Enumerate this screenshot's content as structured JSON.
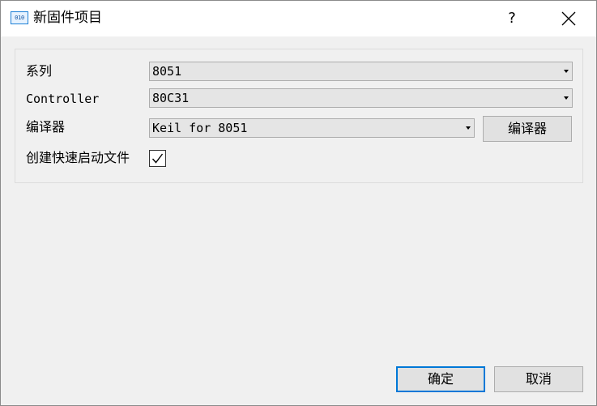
{
  "window": {
    "title": "新固件项目",
    "icon_text": "010",
    "help_label": "?"
  },
  "form": {
    "series_label": "系列",
    "series_value": "8051",
    "controller_label": "Controller",
    "controller_value": "80C31",
    "compiler_label": "编译器",
    "compiler_value": "Keil for 8051",
    "compiler_button": "编译器",
    "startup_label": "创建快速启动文件",
    "startup_checked": true
  },
  "footer": {
    "ok_label": "确定",
    "cancel_label": "取消"
  },
  "colors": {
    "accent": "#0078d7",
    "titlebar": "#ffffff",
    "background": "#f0f0f0"
  }
}
